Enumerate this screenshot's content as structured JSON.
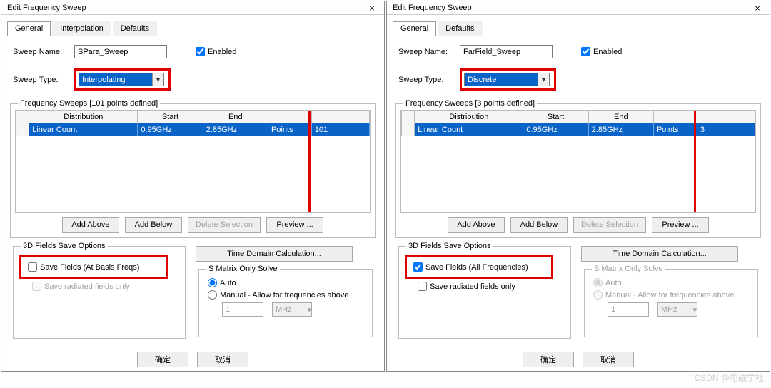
{
  "dialogs": [
    {
      "title": "Edit Frequency Sweep",
      "close_label": "×",
      "tabs": [
        "General",
        "Interpolation",
        "Defaults"
      ],
      "active_tab": "General",
      "sweep_name_label": "Sweep Name:",
      "sweep_name_value": "SPara_Sweep",
      "enabled_label": "Enabled",
      "enabled_checked": true,
      "sweep_type_label": "Sweep Type:",
      "sweep_type_value": "Interpolating",
      "freq_group_label": "Frequency Sweeps [101 points defined]",
      "columns": [
        "Distribution",
        "Start",
        "End",
        "",
        ""
      ],
      "rows": [
        {
          "idx": "1",
          "distribution": "Linear Count",
          "start": "0.95GHz",
          "end": "2.85GHz",
          "type": "Points",
          "value": "101"
        }
      ],
      "btn_add_above": "Add Above",
      "btn_add_below": "Add Below",
      "btn_delete": "Delete Selection",
      "btn_preview": "Preview ...",
      "btn_time_domain": "Time Domain Calculation...",
      "fields_group_label": "3D Fields Save Options",
      "save_fields_label": "Save Fields (At Basis Freqs)",
      "save_fields_checked": false,
      "save_radiated_label": "Save radiated fields only",
      "save_radiated_enabled": false,
      "smatrix_group_label": "S Matrix Only Solve",
      "smatrix_enabled": true,
      "radio_auto_label": "Auto",
      "radio_manual_label": "Manual -   Allow for frequencies above",
      "manual_value": "1",
      "manual_unit": "MHz",
      "btn_ok": "确定",
      "btn_cancel": "取消"
    },
    {
      "title": "Edit Frequency Sweep",
      "close_label": "×",
      "tabs": [
        "General",
        "Defaults"
      ],
      "active_tab": "General",
      "sweep_name_label": "Sweep Name:",
      "sweep_name_value": "FarField_Sweep",
      "enabled_label": "Enabled",
      "enabled_checked": true,
      "sweep_type_label": "Sweep Type:",
      "sweep_type_value": "Discrete",
      "freq_group_label": "Frequency Sweeps [3 points defined]",
      "columns": [
        "Distribution",
        "Start",
        "End",
        "",
        ""
      ],
      "rows": [
        {
          "idx": "1",
          "distribution": "Linear Count",
          "start": "0.95GHz",
          "end": "2.85GHz",
          "type": "Points",
          "value": "3"
        }
      ],
      "btn_add_above": "Add Above",
      "btn_add_below": "Add Below",
      "btn_delete": "Delete Selection",
      "btn_preview": "Preview ...",
      "btn_time_domain": "Time Domain Calculation...",
      "fields_group_label": "3D Fields Save Options",
      "save_fields_label": "Save Fields (All Frequencies)",
      "save_fields_checked": true,
      "save_radiated_label": "Save radiated fields only",
      "save_radiated_enabled": true,
      "smatrix_group_label": "S Matrix Only Solve",
      "smatrix_enabled": false,
      "radio_auto_label": "Auto",
      "radio_manual_label": "Manual -   Allow for frequencies above",
      "manual_value": "1",
      "manual_unit": "MHz",
      "btn_ok": "确定",
      "btn_cancel": "取消"
    }
  ],
  "watermark": "CSDN @电磁学社"
}
